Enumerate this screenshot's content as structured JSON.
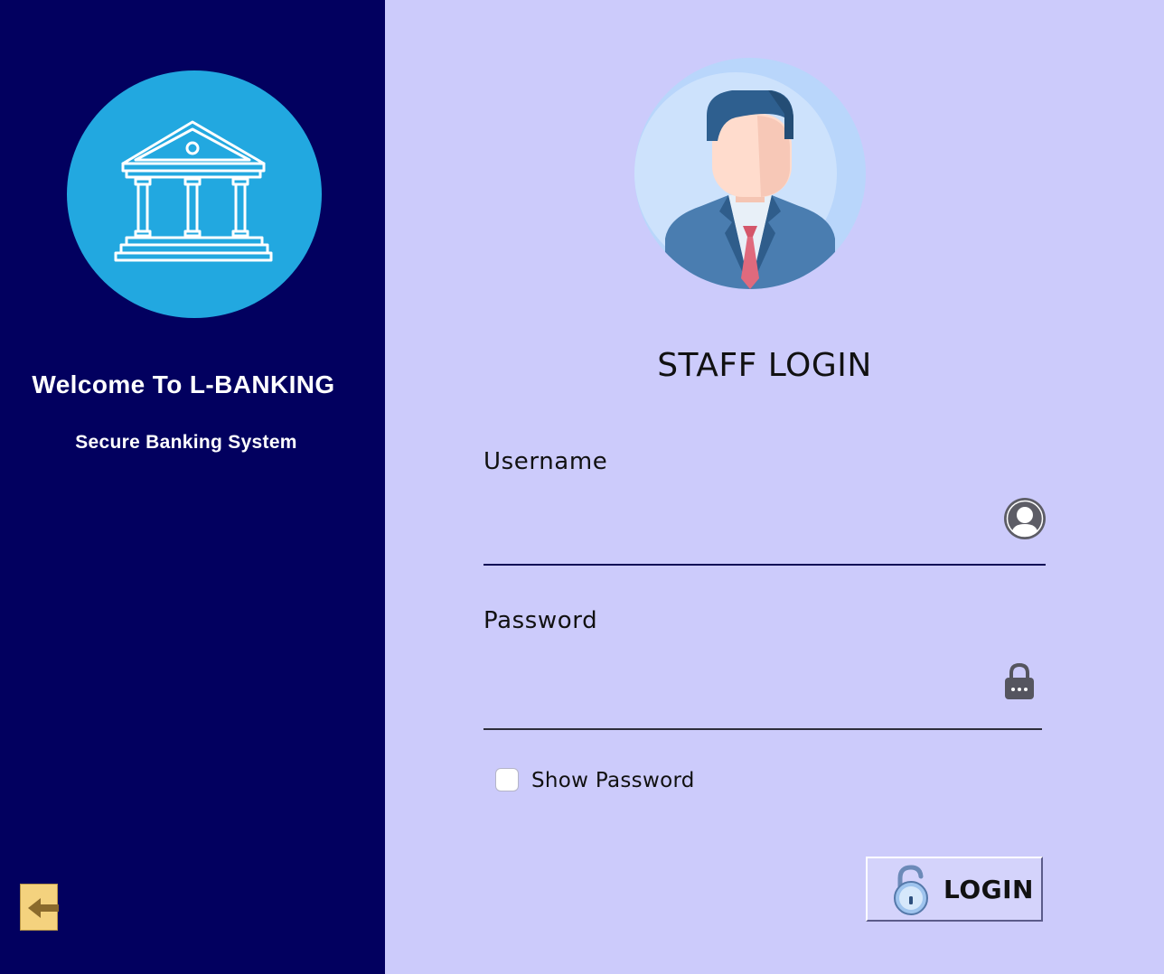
{
  "sidebar": {
    "welcome": "Welcome To L-BANKING",
    "subtitle": "Secure Banking System",
    "logo_icon": "bank-building-icon",
    "back_icon": "arrow-left-icon"
  },
  "login": {
    "title": "STAFF LOGIN",
    "username_label": "Username",
    "username_value": "",
    "password_label": "Password",
    "password_value": "",
    "show_password_label": "Show Password",
    "show_password_checked": false,
    "button_label": "LOGIN",
    "avatar_icon": "staff-avatar-icon"
  },
  "colors": {
    "sidebar_bg": "#02005f",
    "main_bg": "#cccbfb",
    "logo_circle": "#22a8e0",
    "back_button": "#f4d27e"
  }
}
